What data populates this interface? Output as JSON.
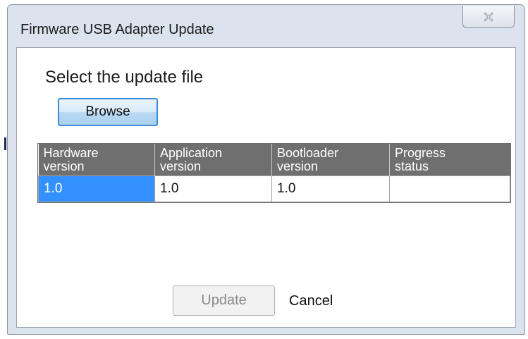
{
  "window": {
    "title": "Firmware USB Adapter Update"
  },
  "prompt": "Select the update file",
  "buttons": {
    "browse": "Browse",
    "update": "Update",
    "cancel": "Cancel"
  },
  "table": {
    "headers": [
      [
        "Hardware",
        "version"
      ],
      [
        "Application",
        "version"
      ],
      [
        "Bootloader",
        "version"
      ],
      [
        "Progress",
        "status"
      ]
    ],
    "rows": [
      [
        "1.0",
        "1.0",
        "1.0",
        ""
      ]
    ]
  },
  "colors": {
    "header_bg": "#6f6f6f",
    "selection": "#3390ff",
    "browse_border": "#3c8bd6"
  },
  "icons": {
    "close": "close-icon"
  }
}
